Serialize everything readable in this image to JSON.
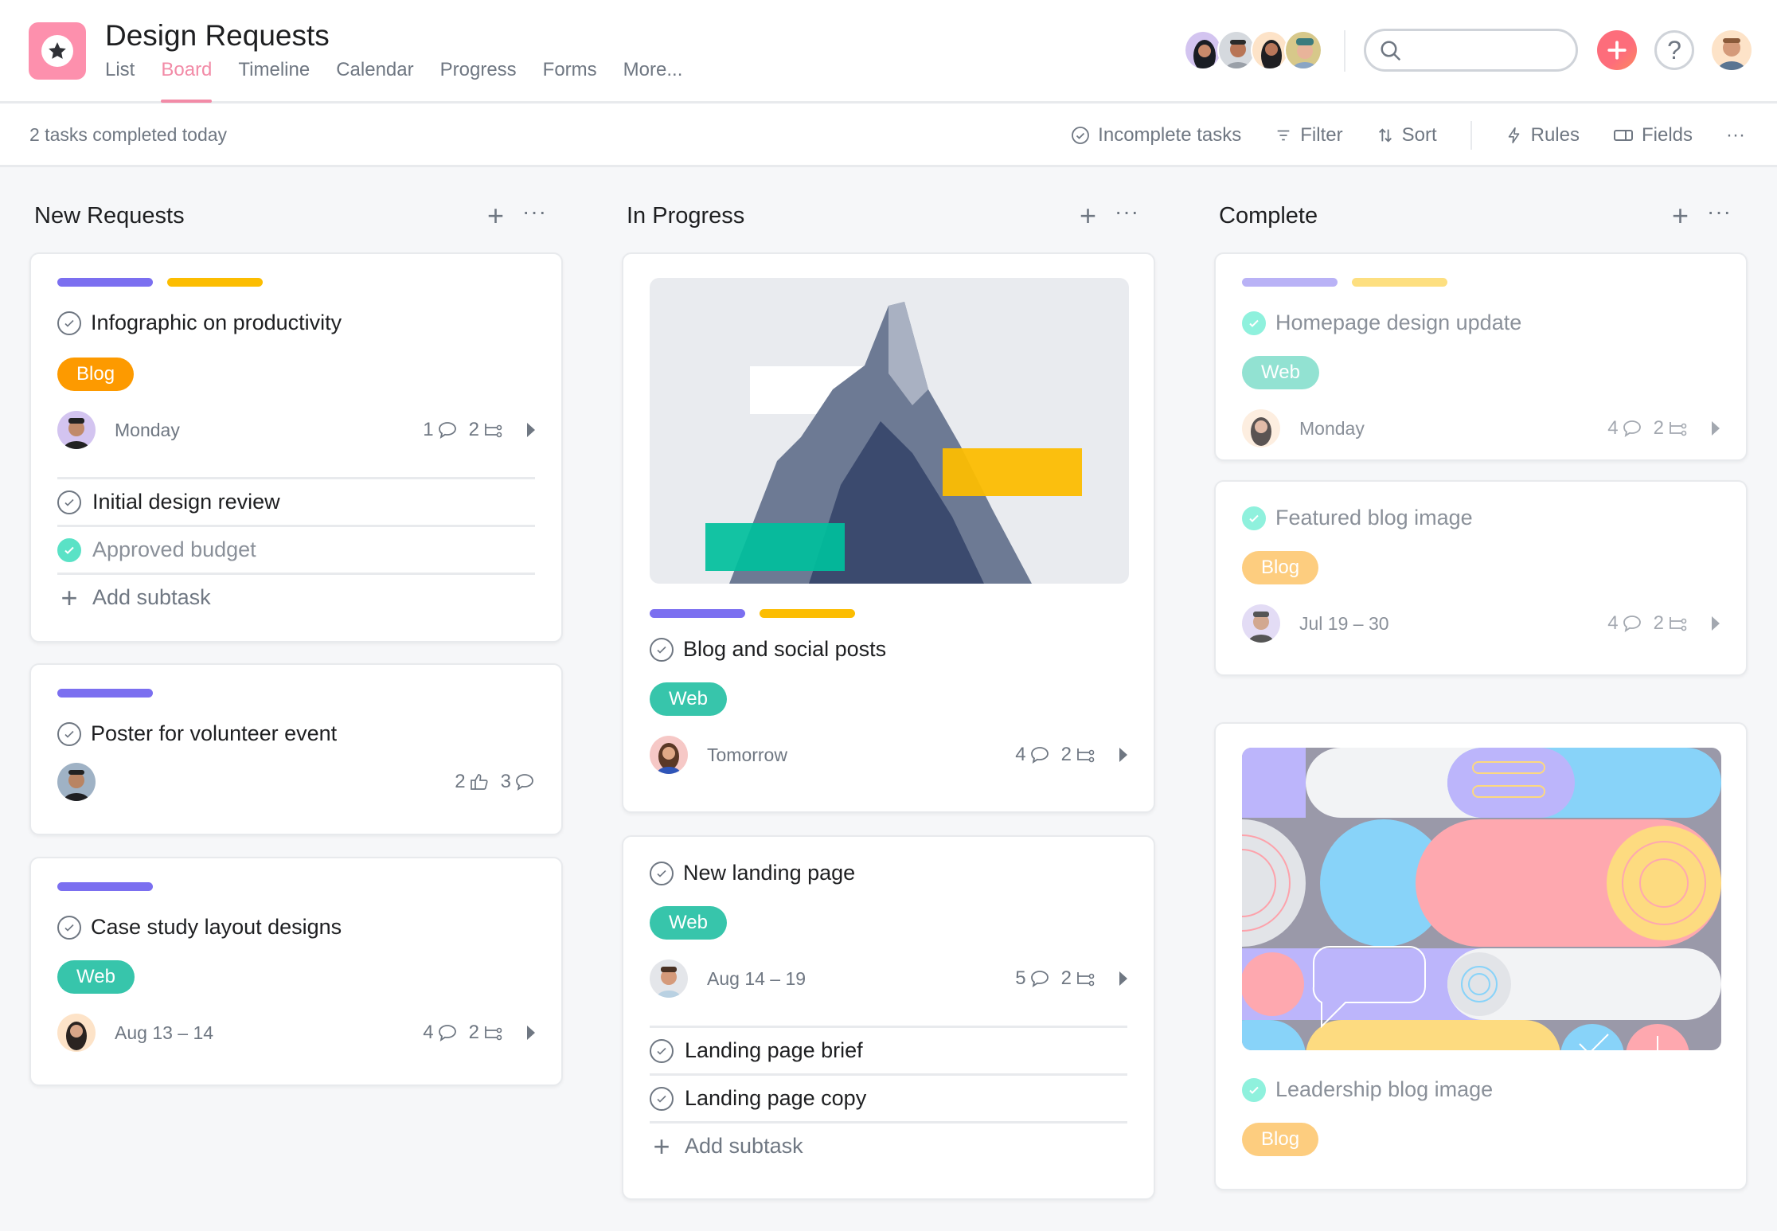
{
  "header": {
    "title": "Design Requests",
    "tabs": [
      {
        "label": "List",
        "active": false
      },
      {
        "label": "Board",
        "active": true
      },
      {
        "label": "Timeline",
        "active": false
      },
      {
        "label": "Calendar",
        "active": false
      },
      {
        "label": "Progress",
        "active": false
      },
      {
        "label": "Forms",
        "active": false
      },
      {
        "label": "More...",
        "active": false
      }
    ],
    "search_placeholder": "",
    "help_label": "?"
  },
  "toolbar": {
    "completed_text": "2 tasks completed today",
    "incomplete_label": "Incomplete tasks",
    "filter_label": "Filter",
    "sort_label": "Sort",
    "rules_label": "Rules",
    "fields_label": "Fields",
    "more_label": "···"
  },
  "colors": {
    "accent": "#f28ba7",
    "purple": "#7b6ff0",
    "yellow": "#fcbd01",
    "blog": "#fd9a00",
    "web": "#37c5ab",
    "complete_check": "#5ae2c6"
  },
  "columns": [
    {
      "title": "New Requests",
      "add_label": "+",
      "more_label": "···",
      "cards": [
        {
          "title": "Infographic on productivity",
          "tag": "Blog",
          "date": "Monday",
          "comments": "1",
          "subtasks": "2",
          "subtask_items": [
            {
              "label": "Initial design review",
              "done": false
            },
            {
              "label": "Approved budget",
              "done": true
            }
          ],
          "add_subtask": "Add subtask"
        },
        {
          "title": "Poster for volunteer event",
          "likes": "2",
          "comments": "3"
        },
        {
          "title": "Case study layout designs",
          "tag": "Web",
          "date": "Aug 13 – 14",
          "comments": "4",
          "subtasks": "2"
        }
      ]
    },
    {
      "title": "In Progress",
      "add_label": "+",
      "more_label": "···",
      "cards": [
        {
          "title": "Blog and social posts",
          "tag": "Web",
          "date": "Tomorrow",
          "comments": "4",
          "subtasks": "2"
        },
        {
          "title": "New landing page",
          "tag": "Web",
          "date": "Aug 14 – 19",
          "comments": "5",
          "subtasks": "2",
          "subtask_items": [
            {
              "label": "Landing page brief",
              "done": false
            },
            {
              "label": "Landing page copy",
              "done": false
            }
          ],
          "add_subtask": "Add subtask"
        }
      ]
    },
    {
      "title": "Complete",
      "add_label": "+",
      "more_label": "···",
      "cards": [
        {
          "title": "Homepage design update",
          "tag": "Web",
          "date": "Monday",
          "comments": "4",
          "subtasks": "2"
        },
        {
          "title": "Featured blog image",
          "tag": "Blog",
          "date": "Jul 19 – 30",
          "comments": "4",
          "subtasks": "2"
        },
        {
          "title": "Leadership blog image",
          "tag": "Blog"
        }
      ]
    }
  ]
}
